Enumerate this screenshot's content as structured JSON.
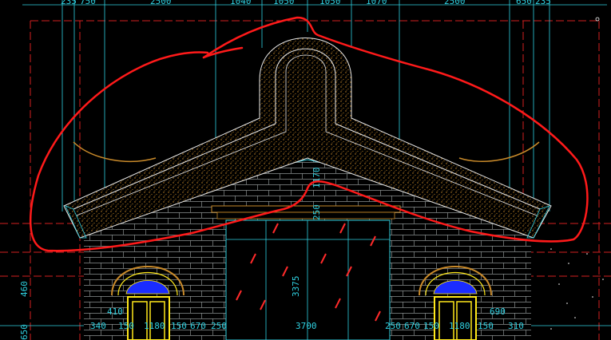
{
  "colors": {
    "background": "#000000",
    "dimension": "#2fd0e0",
    "frame_dashed": "#d42020",
    "roof_outline": "#e8e8e8",
    "roof_fill_dots": "#c98a2a",
    "window_frame": "#ffe81a",
    "window_fan": "#1a2cff",
    "glass_hatch": "#ff2a2a",
    "markup": "#ff1a1a",
    "brick": "#9aa0a0"
  },
  "top_dimensions": [
    "235",
    "750",
    "2500",
    "1040",
    "1050",
    "1050",
    "1070",
    "2500",
    "650",
    "235"
  ],
  "bottom_dimensions": [
    "340",
    "150",
    "1180",
    "150",
    "670",
    "250",
    "3700",
    "250",
    "670",
    "150",
    "1180",
    "150",
    "310"
  ],
  "secondary_dimensions": [
    "410",
    "690"
  ],
  "vertical_dimensions": [
    "460",
    "650",
    "3375",
    "1170",
    "250"
  ],
  "annotation": {
    "note": "red hand-drawn outline marks the roof region"
  }
}
